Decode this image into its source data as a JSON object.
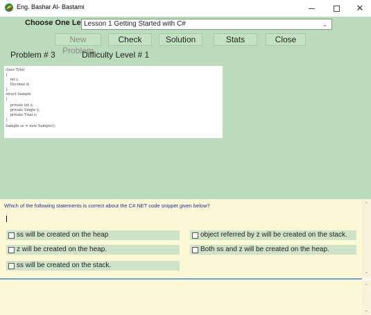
{
  "window": {
    "title": "Eng. Bashar Al- Bastami",
    "icon": "app-logo-icon",
    "controls": [
      "minimize-icon",
      "maximize-icon",
      "close-icon"
    ]
  },
  "lesson": {
    "label": "Choose One Lesson",
    "selected": "Lesson 1 Getting Started with C#"
  },
  "toolbar": {
    "new_problem": "New Problem",
    "check": "Check",
    "solution": "Solution",
    "stats": "Stats",
    "close": "Close"
  },
  "problem": {
    "number_text": "Problem #  3",
    "difficulty_text": "Difficulty Level # 1"
  },
  "code": {
    "lines": [
      "class Trial",
      "{",
      "    int i;",
      "    Decimal d;",
      "}",
      "struct Sample",
      "{",
      "    private int x;",
      "    private Single y;",
      "    private Trial z;",
      "}",
      "Sample ss = new Sample();"
    ]
  },
  "question": {
    "text": "Which of the following statements is correct about the C#.NET code snippet given below?",
    "options": [
      "ss will be created on the heap",
      "object referred by z will be created on the stack.",
      "z will be created on the heap.",
      "Both ss and z will be created on the heap.",
      "ss will be created on the stack."
    ]
  },
  "colors": {
    "panel_green": "#bcdbbc",
    "question_bg": "#fcf8d6",
    "question_text": "#1b2f9a",
    "option_bg": "#cfe3c9",
    "divider": "#6fa6c8"
  }
}
